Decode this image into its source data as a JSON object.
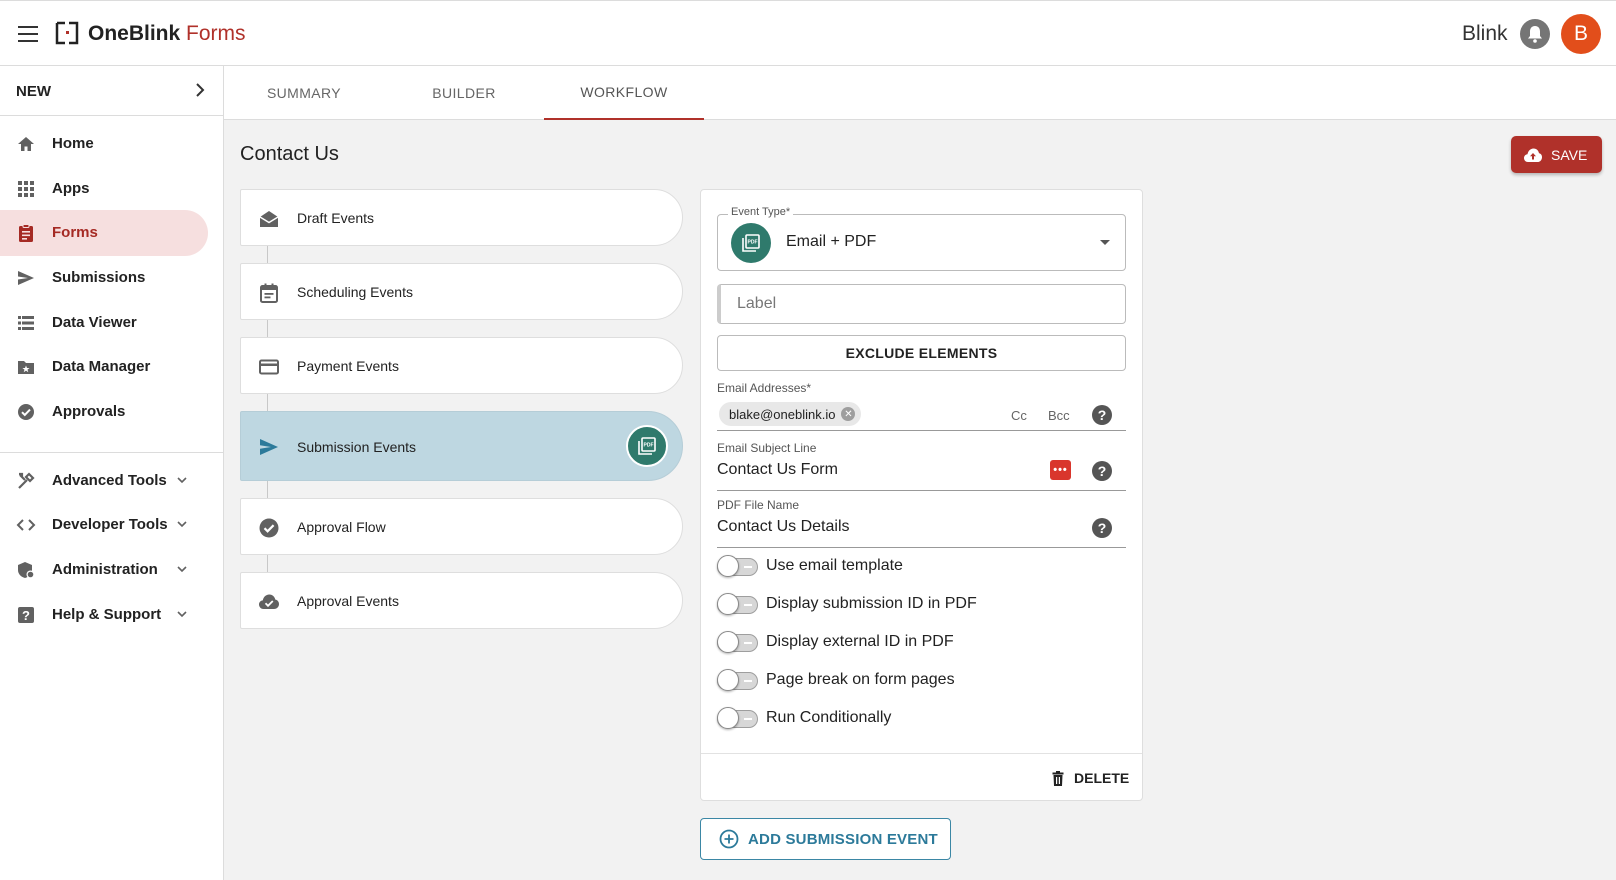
{
  "app": {
    "logo_part1": "OneBlink",
    "logo_part2": "Forms",
    "user_name": "Blink",
    "avatar_letter": "B",
    "brand_color": "#b0312a"
  },
  "sidebar": {
    "new_label": "NEW",
    "items": [
      {
        "label": "Home",
        "icon": "home-icon"
      },
      {
        "label": "Apps",
        "icon": "apps-grid-icon"
      },
      {
        "label": "Forms",
        "icon": "clipboard-icon",
        "active": true
      },
      {
        "label": "Submissions",
        "icon": "send-icon"
      },
      {
        "label": "Data Viewer",
        "icon": "list-icon"
      },
      {
        "label": "Data Manager",
        "icon": "folder-star-icon"
      },
      {
        "label": "Approvals",
        "icon": "check-circle-icon"
      }
    ],
    "groups": [
      {
        "label": "Advanced Tools",
        "icon": "tools-icon"
      },
      {
        "label": "Developer Tools",
        "icon": "code-icon"
      },
      {
        "label": "Administration",
        "icon": "admin-shield-icon"
      },
      {
        "label": "Help & Support",
        "icon": "help-box-icon"
      }
    ]
  },
  "tabs": [
    {
      "label": "SUMMARY"
    },
    {
      "label": "BUILDER"
    },
    {
      "label": "WORKFLOW",
      "active": true
    }
  ],
  "page": {
    "title": "Contact Us",
    "save_label": "SAVE"
  },
  "events": [
    {
      "label": "Draft Events",
      "icon": "drafts-icon"
    },
    {
      "label": "Scheduling Events",
      "icon": "calendar-icon"
    },
    {
      "label": "Payment Events",
      "icon": "credit-card-icon"
    },
    {
      "label": "Submission Events",
      "icon": "send-icon",
      "active": true
    },
    {
      "label": "Approval Flow",
      "icon": "check-circle-icon"
    },
    {
      "label": "Approval Events",
      "icon": "cloud-check-icon"
    }
  ],
  "form": {
    "event_type_legend": "Event Type*",
    "event_type_value": "Email + PDF",
    "label_placeholder": "Label",
    "exclude_label": "EXCLUDE ELEMENTS",
    "email_caption": "Email Addresses*",
    "email_chip": "blake@oneblink.io",
    "cc": "Cc",
    "bcc": "Bcc",
    "subject_caption": "Email Subject Line",
    "subject_value": "Contact Us Form",
    "pdf_caption": "PDF File Name",
    "pdf_value": "Contact Us Details",
    "toggles": [
      {
        "label": "Use email template",
        "on": false
      },
      {
        "label": "Display submission ID in PDF",
        "on": false
      },
      {
        "label": "Display external ID in PDF",
        "on": false
      },
      {
        "label": "Page break on form pages",
        "on": false
      },
      {
        "label": "Run Conditionally",
        "on": false
      }
    ],
    "delete_label": "DELETE",
    "add_label": "ADD SUBMISSION EVENT"
  }
}
